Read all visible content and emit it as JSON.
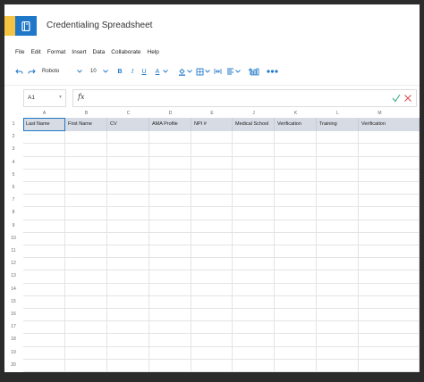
{
  "app": {
    "title": "Credentialing Spreadsheet",
    "brand_color": "#1f77c8",
    "accent_color": "#f5c342"
  },
  "menu": [
    "File",
    "Edit",
    "Format",
    "Insert",
    "Data",
    "Collaborate",
    "Help"
  ],
  "toolbar": {
    "font_name": "Roboto",
    "font_size": "10",
    "bold": "B",
    "italic": "I",
    "underline": "U",
    "text_color": "A"
  },
  "formula_bar": {
    "cell_ref": "A1",
    "fx": "fx",
    "value": ""
  },
  "columns": [
    "A",
    "B",
    "C",
    "D",
    "E",
    "J",
    "K",
    "L",
    "M"
  ],
  "headers": [
    "Last Name",
    "First Name",
    "CV",
    "AMA Profile",
    "NPI #",
    "Medical School",
    "Verification",
    "Training",
    "Verification"
  ],
  "rows": [
    "1",
    "2",
    "3",
    "4",
    "5",
    "6",
    "7",
    "8",
    "9",
    "10",
    "11",
    "12",
    "13",
    "14",
    "15",
    "16",
    "17",
    "18",
    "19",
    "20"
  ]
}
